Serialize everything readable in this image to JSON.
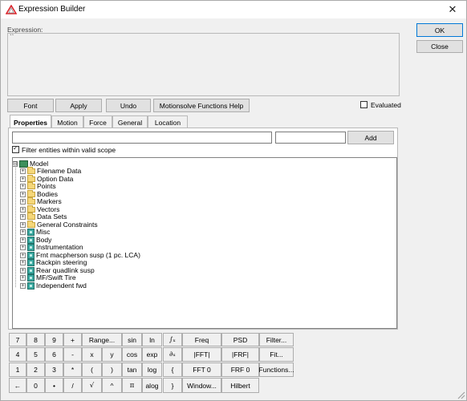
{
  "window": {
    "title": "Expression Builder",
    "icon": "triangle-logo-icon",
    "close_glyph": "✕"
  },
  "expression": {
    "label": "Expression:",
    "value": "``"
  },
  "side_buttons": {
    "ok": "OK",
    "close": "Close"
  },
  "toolbar": {
    "font": "Font",
    "apply": "Apply",
    "undo": "Undo",
    "motionsolve_help": "Motionsolve Functions Help",
    "evaluated_label": "Evaluated",
    "evaluated_checked": false
  },
  "tabs": [
    {
      "label": "Properties",
      "active": true
    },
    {
      "label": "Motion",
      "active": false
    },
    {
      "label": "Force",
      "active": false
    },
    {
      "label": "General",
      "active": false
    },
    {
      "label": "Location",
      "active": false
    }
  ],
  "properties": {
    "search_value": "",
    "secondary_value": "",
    "add_label": "Add",
    "filter_label": "Filter entities within valid scope",
    "filter_checked": true
  },
  "tree": {
    "root": {
      "label": "Model",
      "expander": "⊟",
      "icon": "model-icon"
    },
    "items": [
      {
        "label": "Filename Data",
        "icon": "folder-icon"
      },
      {
        "label": "Option Data",
        "icon": "folder-icon"
      },
      {
        "label": "Points",
        "icon": "folder-icon"
      },
      {
        "label": "Bodies",
        "icon": "folder-icon"
      },
      {
        "label": "Markers",
        "icon": "folder-icon"
      },
      {
        "label": "Vectors",
        "icon": "folder-icon"
      },
      {
        "label": "Data Sets",
        "icon": "folder-icon"
      },
      {
        "label": "General Constraints",
        "icon": "folder-icon"
      },
      {
        "label": "Misc",
        "icon": "system-icon"
      },
      {
        "label": "Body",
        "icon": "system-icon"
      },
      {
        "label": "Instrumentation",
        "icon": "system-icon"
      },
      {
        "label": "Frnt macpherson susp (1 pc. LCA)",
        "icon": "system-icon"
      },
      {
        "label": "Rackpin steering",
        "icon": "system-icon"
      },
      {
        "label": "Rear quadlink susp",
        "icon": "system-icon"
      },
      {
        "label": "MF/Swift Tire",
        "icon": "system-icon"
      },
      {
        "label": "Independent fwd",
        "icon": "system-icon"
      }
    ]
  },
  "keypad": {
    "keys": [
      "7",
      "8",
      "9",
      "+",
      "Range...",
      "sin",
      "ln",
      "∫ₓ",
      "Freq",
      "PSD",
      "Filter...",
      "4",
      "5",
      "6",
      "-",
      "x",
      "y",
      "cos",
      "exp",
      "∂ₓ",
      "|FFT|",
      "|FRF|",
      "Fit...",
      "1",
      "2",
      "3",
      "*",
      "(",
      ")",
      "tan",
      "log",
      "{",
      "FFT 0",
      "FRF 0",
      "Functions...",
      "←",
      "0",
      "•",
      "/",
      "√",
      "^",
      "π",
      "alog",
      "}",
      "Window...",
      "Hilbert"
    ]
  }
}
